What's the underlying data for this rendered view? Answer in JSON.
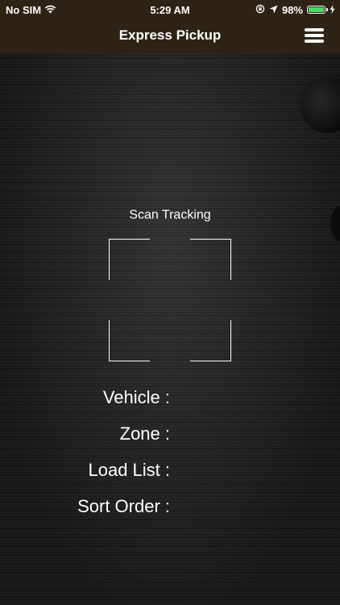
{
  "status_bar": {
    "carrier": "No SIM",
    "time": "5:29 AM",
    "battery_percent": "98%",
    "battery_level": 0.98,
    "icons": [
      "wifi-icon",
      "orientation-lock-icon",
      "location-arrow-icon",
      "battery-icon",
      "charging-icon"
    ]
  },
  "header": {
    "title": "Express Pickup",
    "menu_icon": "hamburger-menu-icon"
  },
  "scanner": {
    "label": "Scan Tracking"
  },
  "details": {
    "vehicle_label": "Vehicle :",
    "vehicle_value": "",
    "zone_label": "Zone :",
    "zone_value": "",
    "load_list_label": "Load List :",
    "load_list_value": "",
    "sort_order_label": "Sort Order :",
    "sort_order_value": ""
  },
  "colors": {
    "header_bg": "#2d2416",
    "battery_green": "#4cd964",
    "text": "#ffffff"
  }
}
